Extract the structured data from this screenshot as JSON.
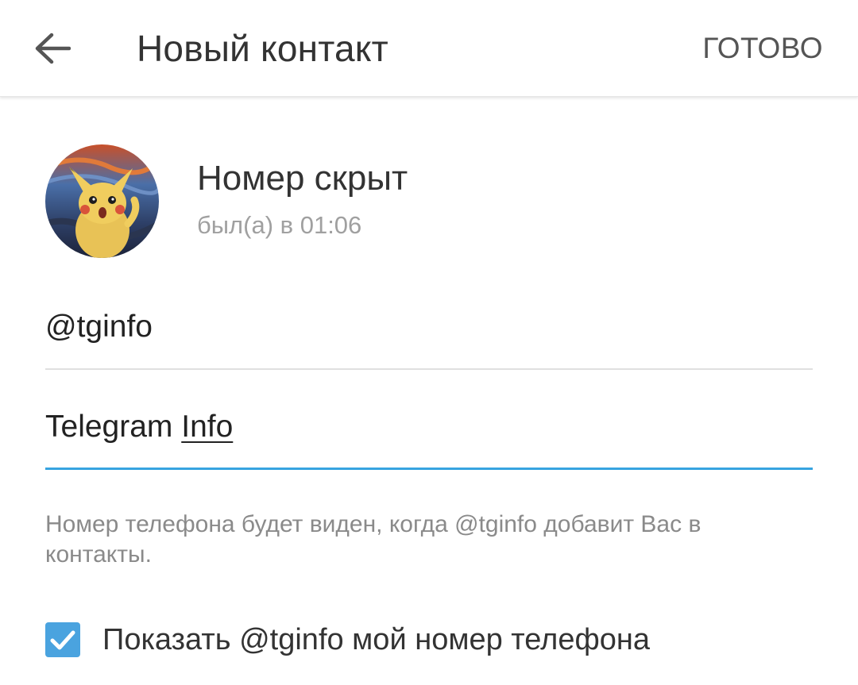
{
  "toolbar": {
    "back_icon": "arrow-left-icon",
    "title": "Новый контакт",
    "done_label": "ГОТОВО"
  },
  "profile": {
    "avatar_icon": "avatar-image",
    "name": "Номер скрыт",
    "status": "был(а) в 01:06"
  },
  "fields": {
    "username": "@tginfo",
    "name_part1": "Telegram ",
    "name_part2": "Info"
  },
  "hint": "Номер телефона будет виден, когда @tginfo добавит Вас в контакты.",
  "share_phone": {
    "checked": true,
    "label": "Показать @tginfo мой номер телефона"
  },
  "colors": {
    "accent": "#37a4e0",
    "checkbox": "#4aa3df",
    "text_primary": "#333333",
    "text_secondary": "#8a8a8a"
  }
}
